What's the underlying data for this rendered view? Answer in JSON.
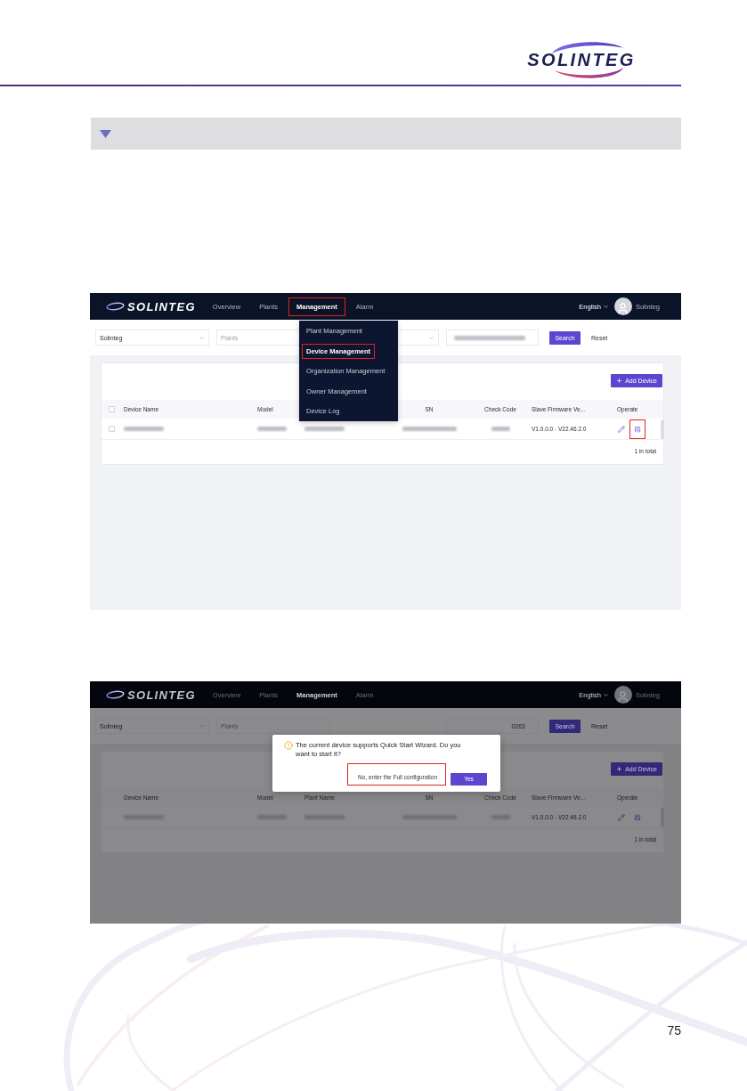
{
  "header": {
    "logo": "SOLINTEG"
  },
  "section_bar": {
    "expanded": true
  },
  "screenshots": [
    {
      "dimmed": false,
      "nav": {
        "logo": "SOLINTEG",
        "items": [
          {
            "label": "Overview",
            "selected": false,
            "highlighted": false
          },
          {
            "label": "Plants",
            "selected": false,
            "highlighted": false
          },
          {
            "label": "Management",
            "selected": true,
            "highlighted": true
          },
          {
            "label": "Alarm",
            "selected": false,
            "highlighted": false
          }
        ],
        "language": "English",
        "user": "Solinteg"
      },
      "filters": [
        {
          "kind": "select",
          "value": "Solinteg",
          "chevron": true
        },
        {
          "kind": "select",
          "placeholder": "Plants",
          "chevron": false
        },
        {
          "kind": "select",
          "chevron": true
        },
        {
          "kind": "input",
          "blurred": true
        }
      ],
      "search_button": "Search",
      "reset_button": "Reset",
      "add_button": "Add Device",
      "table": {
        "selectable": true,
        "select_all_checked": false,
        "columns": [
          {
            "kind": "label",
            "label": "Device Name"
          },
          {
            "kind": "label",
            "label": "Model"
          },
          {
            "kind": "covered"
          },
          {
            "kind": "label",
            "label": "SN"
          },
          {
            "kind": "label",
            "label": "Check Code"
          },
          {
            "kind": "label",
            "label": "Slave Firmware Ve..."
          },
          {
            "kind": "label",
            "label": "Operate"
          }
        ],
        "rows": [
          {
            "checked": false,
            "cells": [
              {
                "kind": "blurred"
              },
              {
                "kind": "blurred"
              },
              {
                "kind": "blurred"
              },
              {
                "kind": "blurred"
              },
              {
                "kind": "blurred"
              },
              {
                "kind": "text",
                "text": "V1.0.0.0 - V22.46.2.0"
              },
              {
                "kind": "actions",
                "actions": [
                  {
                    "kind": "edit",
                    "highlighted": false
                  },
                  {
                    "kind": "configure",
                    "highlighted": true
                  }
                ]
              }
            ]
          }
        ],
        "total": "1 in total"
      },
      "menu": {
        "items": [
          {
            "label": "Plant Management",
            "selected": false,
            "highlighted": false
          },
          {
            "label": "Device Management",
            "selected": true,
            "highlighted": true
          },
          {
            "label": "Organization Management",
            "selected": false,
            "highlighted": false
          },
          {
            "label": "Owner Management",
            "selected": false,
            "highlighted": false
          },
          {
            "label": "Device Log",
            "selected": false,
            "highlighted": false
          }
        ]
      }
    },
    {
      "dimmed": true,
      "nav": {
        "logo": "SOLINTEG",
        "items": [
          {
            "label": "Overview",
            "selected": false,
            "highlighted": false
          },
          {
            "label": "Plants",
            "selected": false,
            "highlighted": false
          },
          {
            "label": "Management",
            "selected": true,
            "highlighted": false
          },
          {
            "label": "Alarm",
            "selected": false,
            "highlighted": false
          }
        ],
        "language": "English",
        "user": "Solinteg"
      },
      "filters": [
        {
          "kind": "select",
          "value": "Solinteg",
          "chevron": true
        },
        {
          "kind": "select",
          "placeholder": "Plants",
          "chevron": false
        },
        {
          "kind": "covered"
        },
        {
          "kind": "input",
          "value": "0263"
        }
      ],
      "search_button": "Search",
      "reset_button": "Reset",
      "add_button": "Add Device",
      "table": {
        "selectable": false,
        "columns": [
          {
            "kind": "label",
            "label": "Device Name"
          },
          {
            "kind": "label",
            "label": "Model"
          },
          {
            "kind": "label",
            "label": "Plant Name"
          },
          {
            "kind": "label",
            "label": "SN"
          },
          {
            "kind": "label",
            "label": "Check Code"
          },
          {
            "kind": "label",
            "label": "Slave Firmware Ve..."
          },
          {
            "kind": "label",
            "label": "Operate"
          }
        ],
        "rows": [
          {
            "cells": [
              {
                "kind": "blurred"
              },
              {
                "kind": "blurred"
              },
              {
                "kind": "blurred"
              },
              {
                "kind": "blurred"
              },
              {
                "kind": "blurred"
              },
              {
                "kind": "text",
                "text": "V1.0.0.0 - V22.46.2.0"
              },
              {
                "kind": "actions",
                "actions": [
                  {
                    "kind": "edit",
                    "highlighted": false
                  },
                  {
                    "kind": "configure",
                    "highlighted": false
                  }
                ]
              }
            ]
          }
        ],
        "total": "1 in total"
      },
      "dialog": {
        "message": "The current device supports Quick Start Wizard. Do you want to start it?",
        "secondary_button": {
          "label": "No, enter the Full configuration",
          "highlighted": true
        },
        "primary_button": "Yes"
      }
    }
  ],
  "page_number": "75"
}
